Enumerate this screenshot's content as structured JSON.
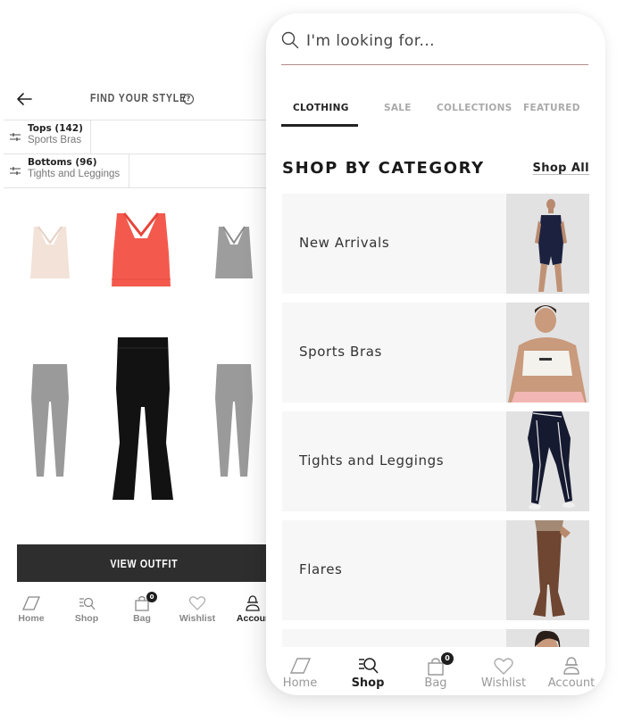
{
  "back_screen": {
    "title": "FIND YOUR STYLE",
    "help_glyph": "?",
    "filters": [
      {
        "title": "Tops (142)",
        "subtitle": "Sports Bras"
      },
      {
        "title": "Bottoms (96)",
        "subtitle": "Tights and Leggings"
      }
    ],
    "outfit_items": {
      "tops": [
        {
          "name": "Sports Bra",
          "color": "#f2e2d8",
          "selected": false
        },
        {
          "name": "Sports Bra",
          "color": "#f35a4d",
          "selected": true
        },
        {
          "name": "Sports Bra",
          "color": "#9d9d9d",
          "selected": false
        }
      ],
      "bottoms": [
        {
          "name": "Leggings",
          "color": "#9a9a9a",
          "selected": false
        },
        {
          "name": "Flares",
          "color": "#121212",
          "selected": true
        },
        {
          "name": "Leggings",
          "color": "#9a9a9a",
          "selected": false
        }
      ]
    },
    "view_outfit_label": "VIEW OUTFIT",
    "nav": [
      {
        "label": "Home",
        "icon": "home-icon",
        "active": false
      },
      {
        "label": "Shop",
        "icon": "shop-icon",
        "active": false
      },
      {
        "label": "Bag",
        "icon": "bag-icon",
        "active": false,
        "badge": "0"
      },
      {
        "label": "Wishlist",
        "icon": "heart-icon",
        "active": false
      },
      {
        "label": "Accour",
        "icon": "account-icon",
        "active": true
      }
    ]
  },
  "front_screen": {
    "search": {
      "placeholder": "I'm looking for...",
      "value": ""
    },
    "tabs": [
      {
        "label": "CLOTHING",
        "active": true
      },
      {
        "label": "SALE",
        "active": false
      },
      {
        "label": "COLLECTIONS",
        "active": false
      },
      {
        "label": "FEATURED",
        "active": false
      }
    ],
    "section_title": "SHOP BY CATEGORY",
    "shop_all_label": "Shop All",
    "categories": [
      {
        "label": "New Arrivals",
        "image": "model in navy bodysuit"
      },
      {
        "label": "Sports Bras",
        "image": "model in white sports bra"
      },
      {
        "label": "Tights and Leggings",
        "image": "model in navy leggings"
      },
      {
        "label": "Flares",
        "image": "model in brown flares"
      },
      {
        "label": "",
        "image": "model portrait"
      }
    ],
    "nav": [
      {
        "label": "Home",
        "icon": "home-icon",
        "active": false
      },
      {
        "label": "Shop",
        "icon": "shop-icon",
        "active": true
      },
      {
        "label": "Bag",
        "icon": "bag-icon",
        "active": false,
        "badge": "0"
      },
      {
        "label": "Wishlist",
        "icon": "heart-icon",
        "active": false
      },
      {
        "label": "Account",
        "icon": "account-icon",
        "active": false
      }
    ]
  }
}
